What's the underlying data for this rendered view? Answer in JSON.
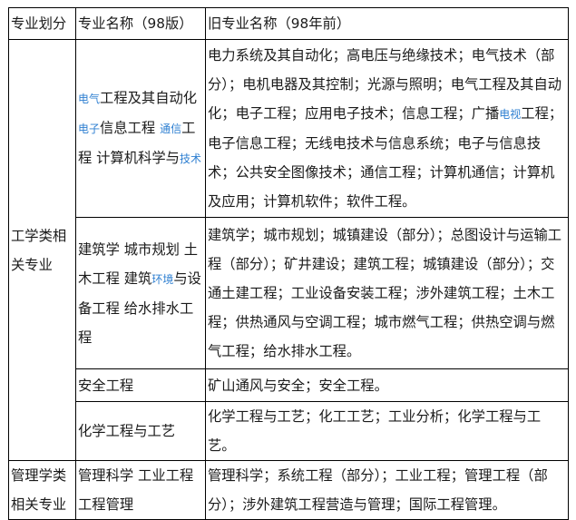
{
  "header": {
    "col1": "专业划分",
    "col2": "专业名称（98版）",
    "col3": "旧专业名称（98年前）"
  },
  "categories": [
    {
      "label": "工学类相关专业"
    },
    {
      "label": "管理学类相关专业"
    }
  ],
  "rows": [
    {
      "major_parts": [
        {
          "text": "电气",
          "link": true,
          "small": true
        },
        {
          "text": "工程及其自动化",
          "link": false
        },
        {
          "text": "电子",
          "link": true,
          "small": true
        },
        {
          "text": "信息工程 ",
          "link": false
        },
        {
          "text": "通信",
          "link": true,
          "small": true
        },
        {
          "text": "工程 计算机科学与",
          "link": false
        },
        {
          "text": "技术",
          "link": true,
          "small": true
        }
      ],
      "old_parts": [
        {
          "text": "电力系统及其自动化；高电压与绝缘技术；电气技术（部分）；电机电器及其控制；光源与照明；电气工程及其自动化；电子工程；应用电子技术；信息工程；广播",
          "link": false
        },
        {
          "text": "电视",
          "link": true,
          "small": true
        },
        {
          "text": "工程；电子信息工程；无线电技术与信息系统；电子与信息技术；公共安全图像技术；通信工程；计算机通信；计算机及应用；计算机软件；软件工程。",
          "link": false
        }
      ]
    },
    {
      "major_parts": [
        {
          "text": "建筑学 城市规划 土木工程 建筑",
          "link": false
        },
        {
          "text": "环境",
          "link": true,
          "small": true
        },
        {
          "text": "与设备工程 给水排水工程",
          "link": false
        }
      ],
      "old_parts": [
        {
          "text": "建筑学；城市规划；城镇建设（部分）；总图设计与运输工程（部分）；矿井建设；建筑工程；城镇建设（部分）；交通土建工程；工业设备安装工程；涉外建筑工程；土木工程；供热通风与空调工程；城市燃气工程；供热空调与燃气工程；给水排水工程。",
          "link": false
        }
      ]
    },
    {
      "major_parts": [
        {
          "text": "安全工程",
          "link": false
        }
      ],
      "old_parts": [
        {
          "text": "矿山通风与安全；安全工程。",
          "link": false
        }
      ]
    },
    {
      "major_parts": [
        {
          "text": "化学工程与工艺",
          "link": false
        }
      ],
      "old_parts": [
        {
          "text": "化学工程与工艺；化工工艺；工业分析；化学工程与工艺。",
          "link": false
        }
      ]
    },
    {
      "major_parts": [
        {
          "text": "管理科学 工业工程 工程管理",
          "link": false
        }
      ],
      "old_parts": [
        {
          "text": "管理科学；系统工程（部分）；工业工程；管理工程（部分）；涉外建筑工程营造与管理；国际工程管理。",
          "link": false
        }
      ]
    }
  ],
  "colors": {
    "link": "#2e7fd1",
    "text": "#1a1a1a",
    "border": "#000000"
  }
}
